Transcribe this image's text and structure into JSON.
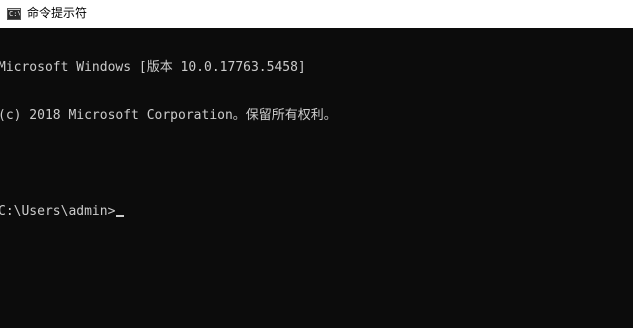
{
  "window": {
    "title": "命令提示符",
    "icon": "cmd-console-icon",
    "icon_glyph": "C:\\"
  },
  "console": {
    "lines": [
      "Microsoft Windows [版本 10.0.17763.5458]",
      "(c) 2018 Microsoft Corporation。保留所有权利。",
      "",
      "C:\\Users\\admin>"
    ]
  },
  "colors": {
    "background": "#0c0c0c",
    "text": "#cccccc",
    "titlebar": "#ffffff"
  }
}
